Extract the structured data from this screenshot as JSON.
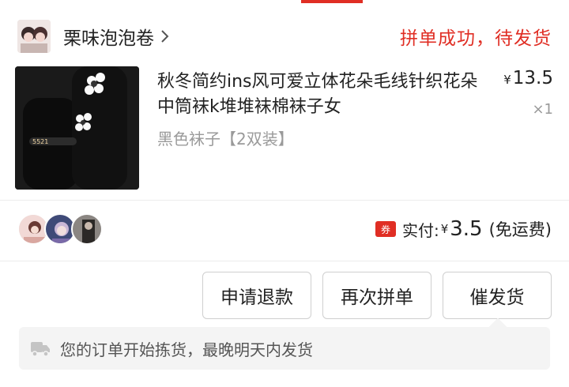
{
  "shop": {
    "name": "栗味泡泡卷",
    "status": "拼单成功，待发货"
  },
  "product": {
    "title": "秋冬简约ins风可爱立体花朵毛线针织花朵中筒袜k堆堆袜棉袜子女",
    "spec": "黑色袜子【2双装】",
    "currency": "¥",
    "price": "13.5",
    "quantity": "×1",
    "thumb_caption": "5521"
  },
  "group": {
    "coupon_badge": "券",
    "paid_label": "实付:",
    "currency": "¥",
    "paid_amount": "3.5",
    "shipping_note": "(免运费)",
    "member_count": 3
  },
  "actions": {
    "refund_label": "申请退款",
    "rebuy_label": "再次拼单",
    "urge_label": "催发货"
  },
  "notice": {
    "icon": "truck-icon",
    "text": "您的订单开始拣货，最晚明天内发货"
  },
  "colors": {
    "accent": "#e02e24",
    "muted_text": "#9a9a9a",
    "notice_bg": "#f4f4f4"
  }
}
